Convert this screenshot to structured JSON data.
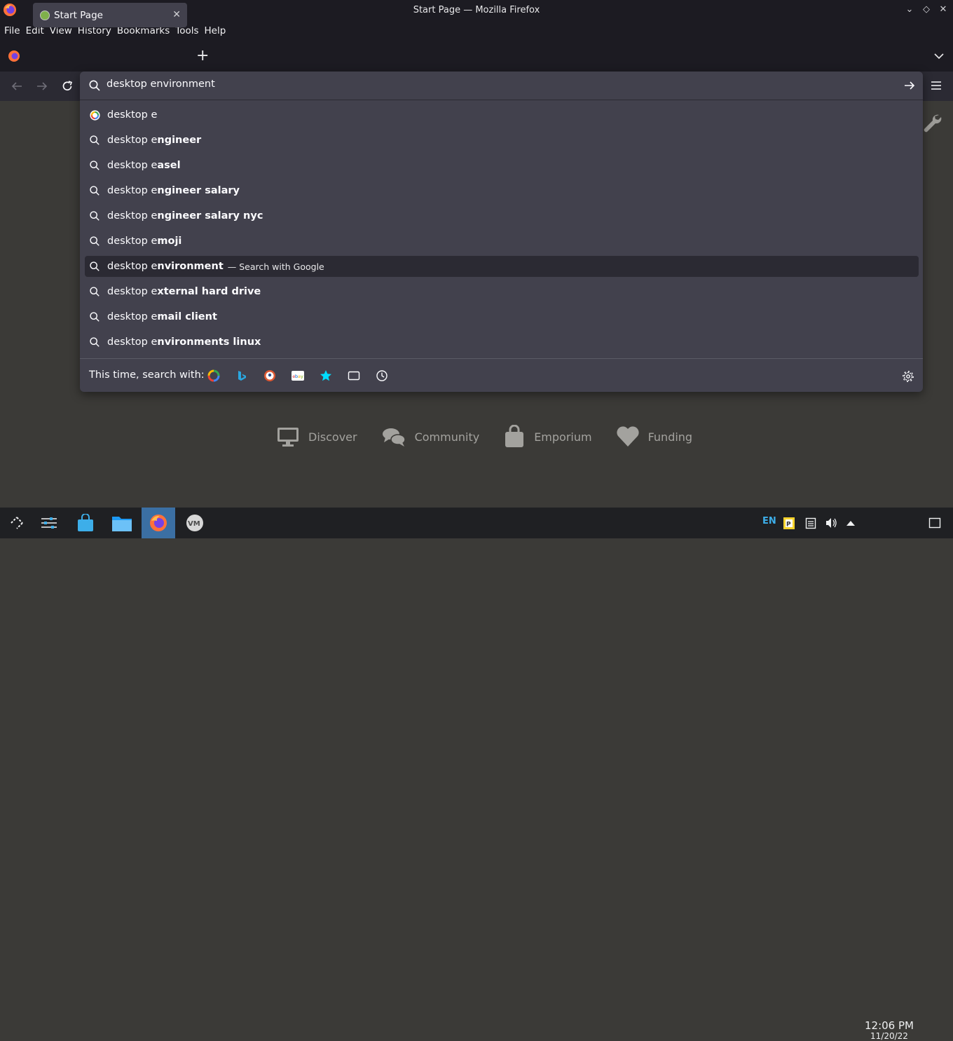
{
  "window": {
    "title": "Start Page — Mozilla Firefox"
  },
  "menu": [
    {
      "label": "File"
    },
    {
      "label": "Edit"
    },
    {
      "label": "View"
    },
    {
      "label": "History"
    },
    {
      "label": "Bookmarks"
    },
    {
      "label": "Tools"
    },
    {
      "label": "Help"
    }
  ],
  "tab": {
    "label": "Start Page"
  },
  "urlbar": {
    "value": "desktop environment"
  },
  "suggestions": [
    {
      "prefix": "desktop e",
      "bold": "",
      "action": "",
      "icon": "google-icon"
    },
    {
      "prefix": "desktop e",
      "bold": "ngineer",
      "action": "",
      "icon": "search-icon"
    },
    {
      "prefix": "desktop e",
      "bold": "asel",
      "action": "",
      "icon": "search-icon"
    },
    {
      "prefix": "desktop e",
      "bold": "ngineer salary",
      "action": "",
      "icon": "search-icon"
    },
    {
      "prefix": "desktop e",
      "bold": "ngineer salary nyc",
      "action": "",
      "icon": "search-icon"
    },
    {
      "prefix": "desktop e",
      "bold": "moji",
      "action": "",
      "icon": "search-icon"
    },
    {
      "prefix": "desktop e",
      "bold": "nvironment",
      "action": "—  Search with Google",
      "icon": "search-icon",
      "selected": true
    },
    {
      "prefix": "desktop e",
      "bold": "xternal hard drive",
      "action": "",
      "icon": "search-icon"
    },
    {
      "prefix": "desktop e",
      "bold": "mail client",
      "action": "",
      "icon": "search-icon"
    },
    {
      "prefix": "desktop e",
      "bold": "nvironments linux",
      "action": "",
      "icon": "search-icon"
    }
  ],
  "oneoff": {
    "label": "This time, search with:",
    "engines": [
      "google-icon",
      "bing-icon",
      "duckduckgo-icon",
      "ebay-icon",
      "bookmarks-star-icon",
      "tabs-icon",
      "history-clock-icon"
    ]
  },
  "page_links": [
    {
      "label": "Discover",
      "icon": "monitor-icon"
    },
    {
      "label": "Community",
      "icon": "chat-icon"
    },
    {
      "label": "Emporium",
      "icon": "shopping-bag-icon"
    },
    {
      "label": "Funding",
      "icon": "heart-icon"
    }
  ],
  "taskbar": {
    "language": "EN",
    "time": "12:06 PM",
    "date": "11/20/22"
  },
  "colors": {
    "accent": "#3daee9",
    "panel": "#42414d",
    "toolbar": "#2b2a33",
    "chrome": "#1c1b22",
    "page": "#3b3a37"
  }
}
